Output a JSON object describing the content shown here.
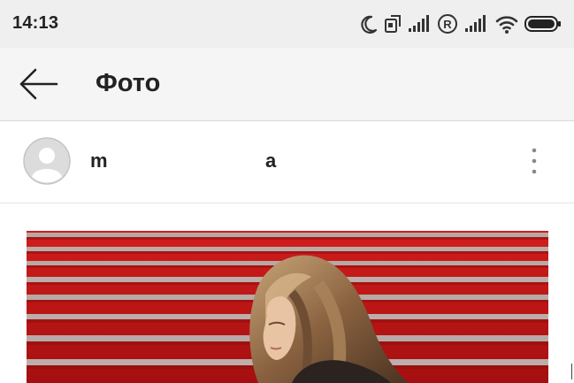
{
  "status_bar": {
    "time": "14:13",
    "icons": [
      "moon-icon",
      "rotate-icon",
      "signal-icon",
      "registered-icon",
      "signal-icon",
      "wifi-icon",
      "battery-icon"
    ]
  },
  "app_bar": {
    "back_icon": "arrow-left-icon",
    "title": "Фото"
  },
  "post": {
    "username_start": "m",
    "username_end": "a",
    "avatar_icon": "default-avatar-icon",
    "more_icon": "more-vertical-icon"
  },
  "colors": {
    "status_bar_bg": "#efefef",
    "app_bar_bg": "#f5f5f5",
    "photo_red": "#c01616"
  }
}
